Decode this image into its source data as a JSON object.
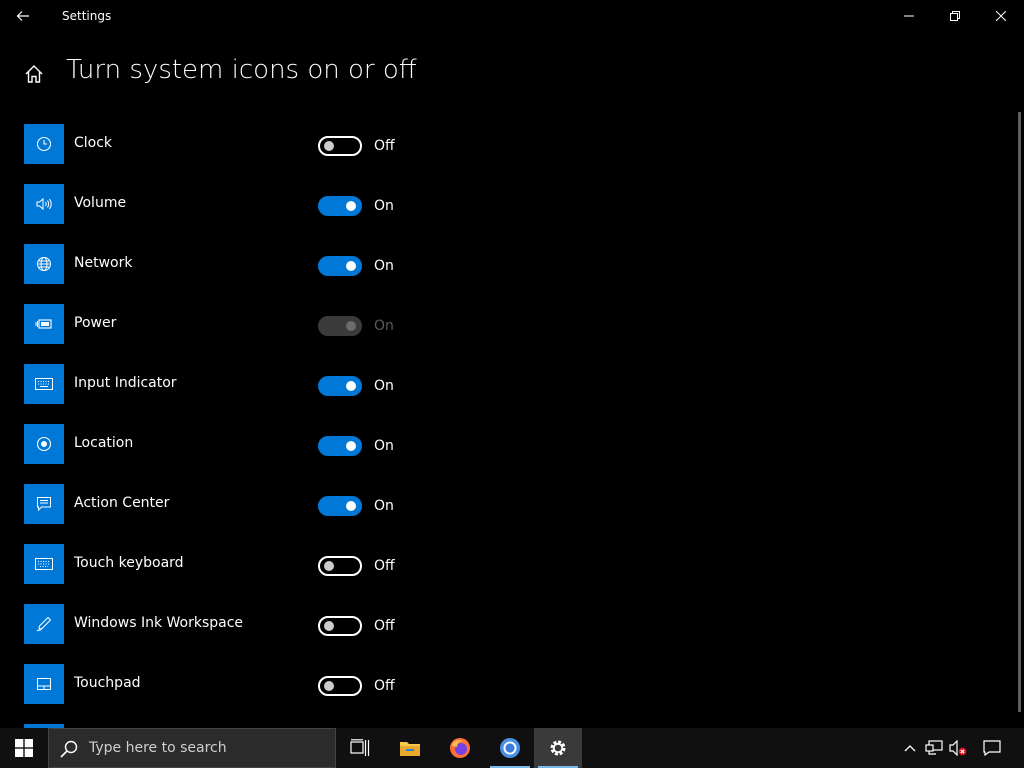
{
  "window": {
    "title": "Settings"
  },
  "page": {
    "title": "Turn system icons on or off"
  },
  "items": [
    {
      "label": "Clock",
      "state": "Off",
      "on": false,
      "disabled": false,
      "icon": "clock-icon"
    },
    {
      "label": "Volume",
      "state": "On",
      "on": true,
      "disabled": false,
      "icon": "volume-icon"
    },
    {
      "label": "Network",
      "state": "On",
      "on": true,
      "disabled": false,
      "icon": "globe-icon"
    },
    {
      "label": "Power",
      "state": "On",
      "on": true,
      "disabled": true,
      "icon": "battery-icon"
    },
    {
      "label": "Input Indicator",
      "state": "On",
      "on": true,
      "disabled": false,
      "icon": "keyboard-icon"
    },
    {
      "label": "Location",
      "state": "On",
      "on": true,
      "disabled": false,
      "icon": "location-icon"
    },
    {
      "label": "Action Center",
      "state": "On",
      "on": true,
      "disabled": false,
      "icon": "action-center-icon"
    },
    {
      "label": "Touch keyboard",
      "state": "Off",
      "on": false,
      "disabled": false,
      "icon": "touch-keyboard-icon"
    },
    {
      "label": "Windows Ink Workspace",
      "state": "Off",
      "on": false,
      "disabled": false,
      "icon": "pen-icon"
    },
    {
      "label": "Touchpad",
      "state": "Off",
      "on": false,
      "disabled": false,
      "icon": "touchpad-icon"
    }
  ],
  "taskbar": {
    "search_placeholder": "Type here to search"
  },
  "colors": {
    "accent": "#0078d7",
    "background": "#000000",
    "taskbar": "#101010"
  }
}
